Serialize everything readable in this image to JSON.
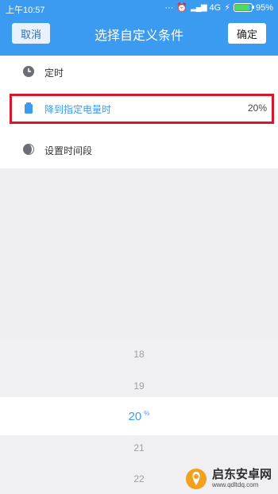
{
  "status_bar": {
    "time": "上午10:57",
    "network": "4G",
    "battery_percent": "95%",
    "battery_level": 0.95
  },
  "header": {
    "cancel_label": "取消",
    "title": "选择自定义条件",
    "confirm_label": "确定"
  },
  "options": [
    {
      "label": "定时",
      "value": "",
      "icon": "clock-icon"
    },
    {
      "label": "降到指定电量时",
      "value": "20%",
      "icon": "battery-icon"
    },
    {
      "label": "设置时间段",
      "value": "",
      "icon": "half-moon-icon"
    }
  ],
  "picker": {
    "items": [
      "18",
      "19",
      "20",
      "21",
      "22"
    ],
    "selected_index": 2,
    "unit": "%"
  },
  "watermark": {
    "name": "启东安卓网",
    "url": "www.qdltdq.com"
  },
  "colors": {
    "accent": "#3a9bf0",
    "highlight_border": "#d7182a"
  }
}
